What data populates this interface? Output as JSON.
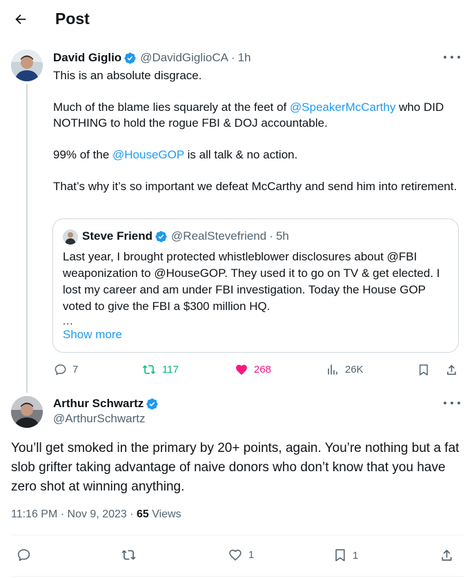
{
  "header": {
    "title": "Post",
    "back_icon": "arrow-left-icon"
  },
  "colors": {
    "accent": "#1d9bf0",
    "text": "#0f1419",
    "muted": "#536471",
    "retweet": "#00ba7c",
    "like": "#f91880",
    "border": "#cfd9de"
  },
  "main_post": {
    "display_name": "David Giglio",
    "handle": "@DavidGiglioCA",
    "separator": "·",
    "time": "1h",
    "paragraphs": [
      {
        "text": "This is an absolute disgrace."
      },
      {
        "before": "Much of the blame lies squarely at the feet of ",
        "mention": "@SpeakerMcCarthy",
        "after": " who DID NOTHING to hold the rogue FBI & DOJ accountable."
      },
      {
        "before": "99% of the ",
        "mention": "@HouseGOP",
        "after": " is all talk & no action."
      },
      {
        "text": "That’s why it’s so important we defeat McCarthy and send him into retirement."
      }
    ],
    "quote": {
      "display_name": "Steve Friend",
      "handle": "@RealStevefriend",
      "separator": "·",
      "time": "5h",
      "text": "Last year, I brought protected whistleblower disclosures about @FBI weaponization to @HouseGOP. They used it to go on TV & get elected. I lost my career and am under FBI investigation. Today the House GOP voted to give the FBI a $300 million HQ.",
      "ellipsis": "...",
      "show_more": "Show more"
    },
    "actions": {
      "replies": "7",
      "reposts": "117",
      "likes": "268",
      "views": "26K"
    }
  },
  "reply_post": {
    "display_name": "Arthur Schwartz",
    "handle": "@ArthurSchwartz",
    "text": "You’ll get smoked in the primary by 20+ points, again. You’re nothing but a fat slob grifter taking advantage of naive donors who don’t know that you have zero shot at winning anything.",
    "timestamp": "11:16 PM · Nov 9, 2023",
    "meta_separator": "·",
    "views_count": "65",
    "views_label": "Views",
    "actions": {
      "replies": "",
      "reposts": "",
      "likes": "1",
      "bookmarks": "1"
    }
  }
}
